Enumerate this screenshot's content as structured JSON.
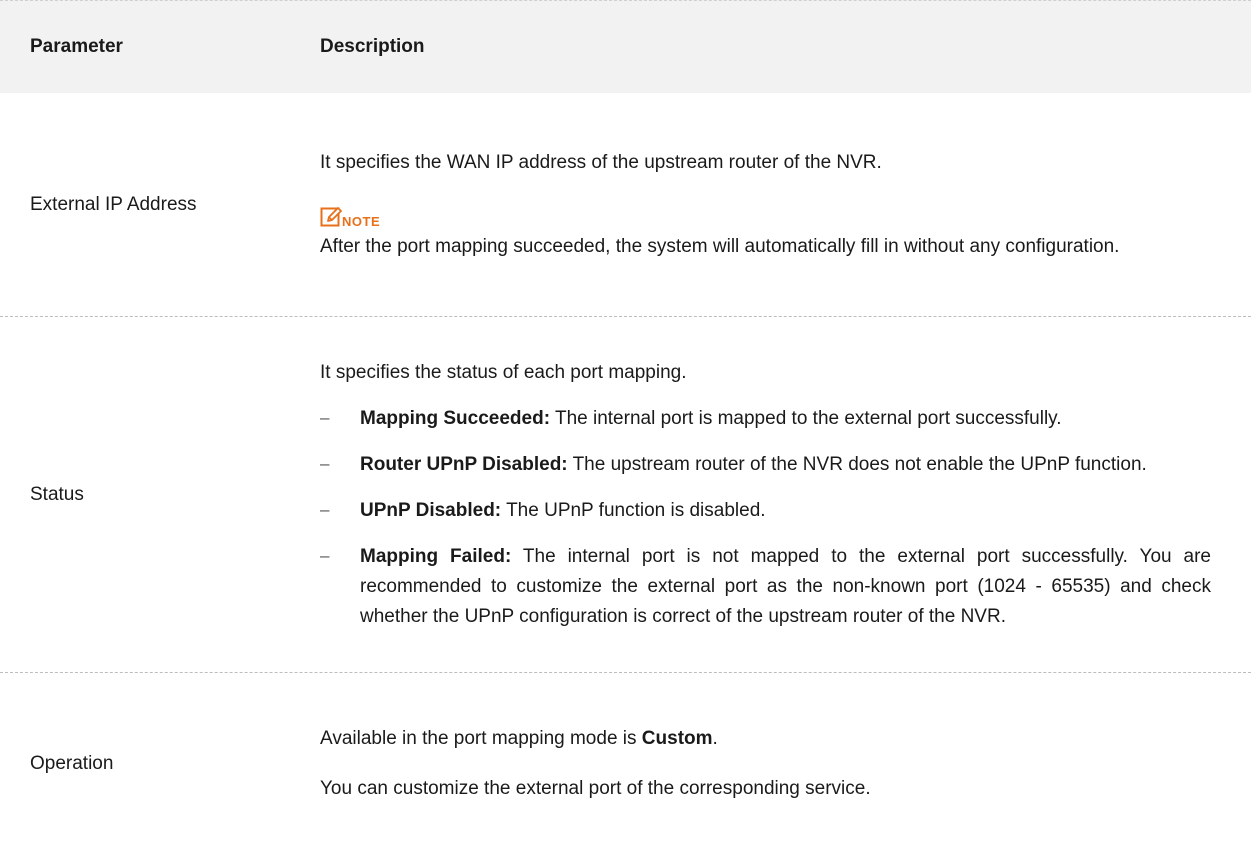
{
  "header": {
    "param": "Parameter",
    "desc": "Description"
  },
  "rows": {
    "external_ip": {
      "param": "External IP Address",
      "desc": "It specifies the WAN IP address of the upstream router of the NVR.",
      "note_label": "NOTE",
      "note_text": "After the port mapping succeeded, the system will automatically fill in without any configuration."
    },
    "status": {
      "param": "Status",
      "desc": "It specifies the status of each port mapping.",
      "items": [
        {
          "term": "Mapping Succeeded:",
          "text": " The internal port is mapped to the external port successfully."
        },
        {
          "term": "Router UPnP Disabled:",
          "text": " The upstream router of the NVR does not enable the UPnP function."
        },
        {
          "term": "UPnP Disabled:",
          "text": " The UPnP function is disabled."
        },
        {
          "term": "Mapping Failed:",
          "text": " The internal port is not mapped to the external port successfully. You are recommended to customize the external port as the non-known port (1024 - 65535) and check whether the UPnP configuration is correct of the upstream router of the NVR."
        }
      ],
      "dash": "–"
    },
    "operation": {
      "param": "Operation",
      "desc_prefix": "Available in the port mapping mode is ",
      "desc_bold": "Custom",
      "desc_suffix": ".",
      "desc2": "You can customize the external port of the corresponding service."
    }
  },
  "colors": {
    "note_accent": "#e8701a",
    "header_bg": "#f2f2f2"
  }
}
